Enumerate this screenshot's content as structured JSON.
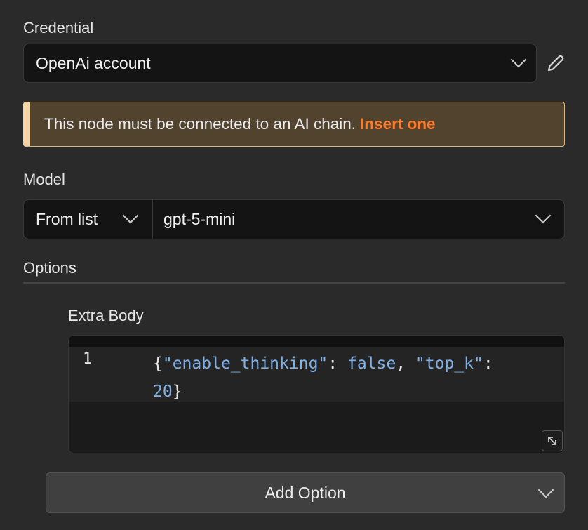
{
  "credential": {
    "label": "Credential",
    "value": "OpenAi account",
    "edit_icon": "pencil-icon"
  },
  "banner": {
    "text": "This node must be connected to an AI chain.",
    "link": "Insert one",
    "colors": {
      "background": "#52432e",
      "accent": "#f3d4a4",
      "link": "#ff7a29"
    }
  },
  "model": {
    "label": "Model",
    "mode": "From list",
    "value": "gpt-5-mini"
  },
  "options": {
    "label": "Options",
    "extra_body": {
      "label": "Extra Body",
      "line_number": "1",
      "code": {
        "open": "{",
        "k1": "\"enable_thinking\"",
        "sep1": ": ",
        "v1": "false",
        "comma": ", ",
        "k2": "\"top_k\"",
        "sep2": ": ",
        "v2": "20",
        "close": "}"
      }
    },
    "add_option": "Add Option"
  }
}
